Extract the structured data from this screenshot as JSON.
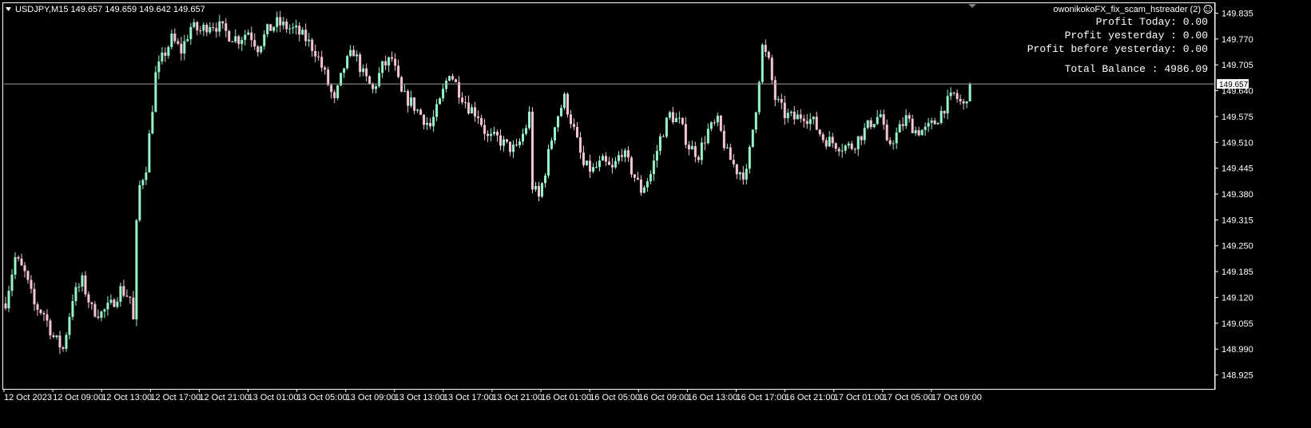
{
  "header": {
    "symbol_line": "USDJPY,M15  149.657 149.659 149.642 149.657",
    "expert_name": "owonikokoFX_fix_scam_hstreader (2)"
  },
  "info_panel": {
    "profit_today": "Profit Today: 0.00",
    "profit_yesterday": "Profit yesterday : 0.00",
    "profit_before_yesterday": "Profit before yesterday: 0.00",
    "total_balance": "Total Balance : 4986.09"
  },
  "colors": {
    "background": "#000000",
    "bull": "#98f5c8",
    "bear": "#f7c6d6",
    "grid": "#ffffff",
    "price_line": "#9a9a9a"
  },
  "chart_data": {
    "type": "candlestick",
    "symbol": "USDJPY",
    "timeframe": "M15",
    "current_price": 149.657,
    "current_price_label": "149.657",
    "ylim": [
      148.89,
      149.86
    ],
    "y_ticks": [
      "149.835",
      "149.770",
      "149.705",
      "149.640",
      "149.575",
      "149.510",
      "149.445",
      "149.380",
      "149.315",
      "149.250",
      "149.185",
      "149.120",
      "149.055",
      "148.990",
      "148.925"
    ],
    "x_ticks": [
      "12 Oct 2023",
      "12 Oct 09:00",
      "12 Oct 13:00",
      "12 Oct 17:00",
      "12 Oct 21:00",
      "13 Oct 01:00",
      "13 Oct 05:00",
      "13 Oct 09:00",
      "13 Oct 13:00",
      "13 Oct 17:00",
      "13 Oct 21:00",
      "16 Oct 01:00",
      "16 Oct 05:00",
      "16 Oct 09:00",
      "16 Oct 13:00",
      "16 Oct 17:00",
      "16 Oct 21:00",
      "17 Oct 01:00",
      "17 Oct 05:00",
      "17 Oct 09:00"
    ],
    "close_path": [
      [
        0,
        149.11
      ],
      [
        3,
        149.22
      ],
      [
        6,
        149.18
      ],
      [
        9,
        149.1
      ],
      [
        12,
        149.08
      ],
      [
        15,
        149.02
      ],
      [
        18,
        148.99
      ],
      [
        21,
        149.12
      ],
      [
        24,
        149.16
      ],
      [
        27,
        149.09
      ],
      [
        30,
        149.08
      ],
      [
        33,
        149.1
      ],
      [
        36,
        149.14
      ],
      [
        39,
        149.12
      ],
      [
        40,
        149.06
      ],
      [
        41,
        149.3
      ],
      [
        42,
        149.4
      ],
      [
        44,
        149.45
      ],
      [
        46,
        149.6
      ],
      [
        47,
        149.68
      ],
      [
        49,
        149.72
      ],
      [
        52,
        149.77
      ],
      [
        55,
        149.74
      ],
      [
        58,
        149.8
      ],
      [
        61,
        149.79
      ],
      [
        64,
        149.81
      ],
      [
        67,
        149.8
      ],
      [
        70,
        149.78
      ],
      [
        73,
        149.77
      ],
      [
        76,
        149.79
      ],
      [
        79,
        149.75
      ],
      [
        82,
        149.79
      ],
      [
        85,
        149.81
      ],
      [
        88,
        149.8
      ],
      [
        91,
        149.79
      ],
      [
        94,
        149.77
      ],
      [
        97,
        149.74
      ],
      [
        100,
        149.68
      ],
      [
        103,
        149.61
      ],
      [
        106,
        149.7
      ],
      [
        109,
        149.74
      ],
      [
        112,
        149.68
      ],
      [
        115,
        149.64
      ],
      [
        118,
        149.7
      ],
      [
        121,
        149.72
      ],
      [
        124,
        149.63
      ],
      [
        127,
        149.61
      ],
      [
        130,
        149.58
      ],
      [
        133,
        149.55
      ],
      [
        136,
        149.61
      ],
      [
        139,
        149.69
      ],
      [
        142,
        149.64
      ],
      [
        145,
        149.6
      ],
      [
        148,
        149.58
      ],
      [
        151,
        149.52
      ],
      [
        154,
        149.52
      ],
      [
        157,
        149.5
      ],
      [
        160,
        149.49
      ],
      [
        163,
        149.55
      ],
      [
        164,
        149.58
      ],
      [
        165,
        149.4
      ],
      [
        167,
        149.37
      ],
      [
        169,
        149.44
      ],
      [
        172,
        149.56
      ],
      [
        175,
        149.62
      ],
      [
        178,
        149.54
      ],
      [
        181,
        149.45
      ],
      [
        184,
        149.44
      ],
      [
        187,
        149.46
      ],
      [
        190,
        149.44
      ],
      [
        193,
        149.49
      ],
      [
        196,
        149.44
      ],
      [
        199,
        149.39
      ],
      [
        202,
        149.43
      ],
      [
        205,
        149.52
      ],
      [
        208,
        149.58
      ],
      [
        211,
        149.56
      ],
      [
        214,
        149.5
      ],
      [
        217,
        149.48
      ],
      [
        220,
        149.54
      ],
      [
        223,
        149.56
      ],
      [
        226,
        149.48
      ],
      [
        229,
        149.44
      ],
      [
        232,
        149.43
      ],
      [
        235,
        149.6
      ],
      [
        237,
        149.75
      ],
      [
        239,
        149.71
      ],
      [
        241,
        149.62
      ],
      [
        244,
        149.58
      ],
      [
        247,
        149.57
      ],
      [
        250,
        149.58
      ],
      [
        253,
        149.56
      ],
      [
        256,
        149.52
      ],
      [
        259,
        149.51
      ],
      [
        262,
        149.5
      ],
      [
        265,
        149.5
      ],
      [
        268,
        149.53
      ],
      [
        271,
        149.56
      ],
      [
        274,
        149.58
      ],
      [
        276,
        149.5
      ],
      [
        279,
        149.53
      ],
      [
        282,
        149.57
      ],
      [
        285,
        149.54
      ],
      [
        288,
        149.54
      ],
      [
        291,
        149.56
      ],
      [
        294,
        149.6
      ],
      [
        297,
        149.63
      ],
      [
        300,
        149.6
      ],
      [
        302,
        149.66
      ]
    ]
  }
}
